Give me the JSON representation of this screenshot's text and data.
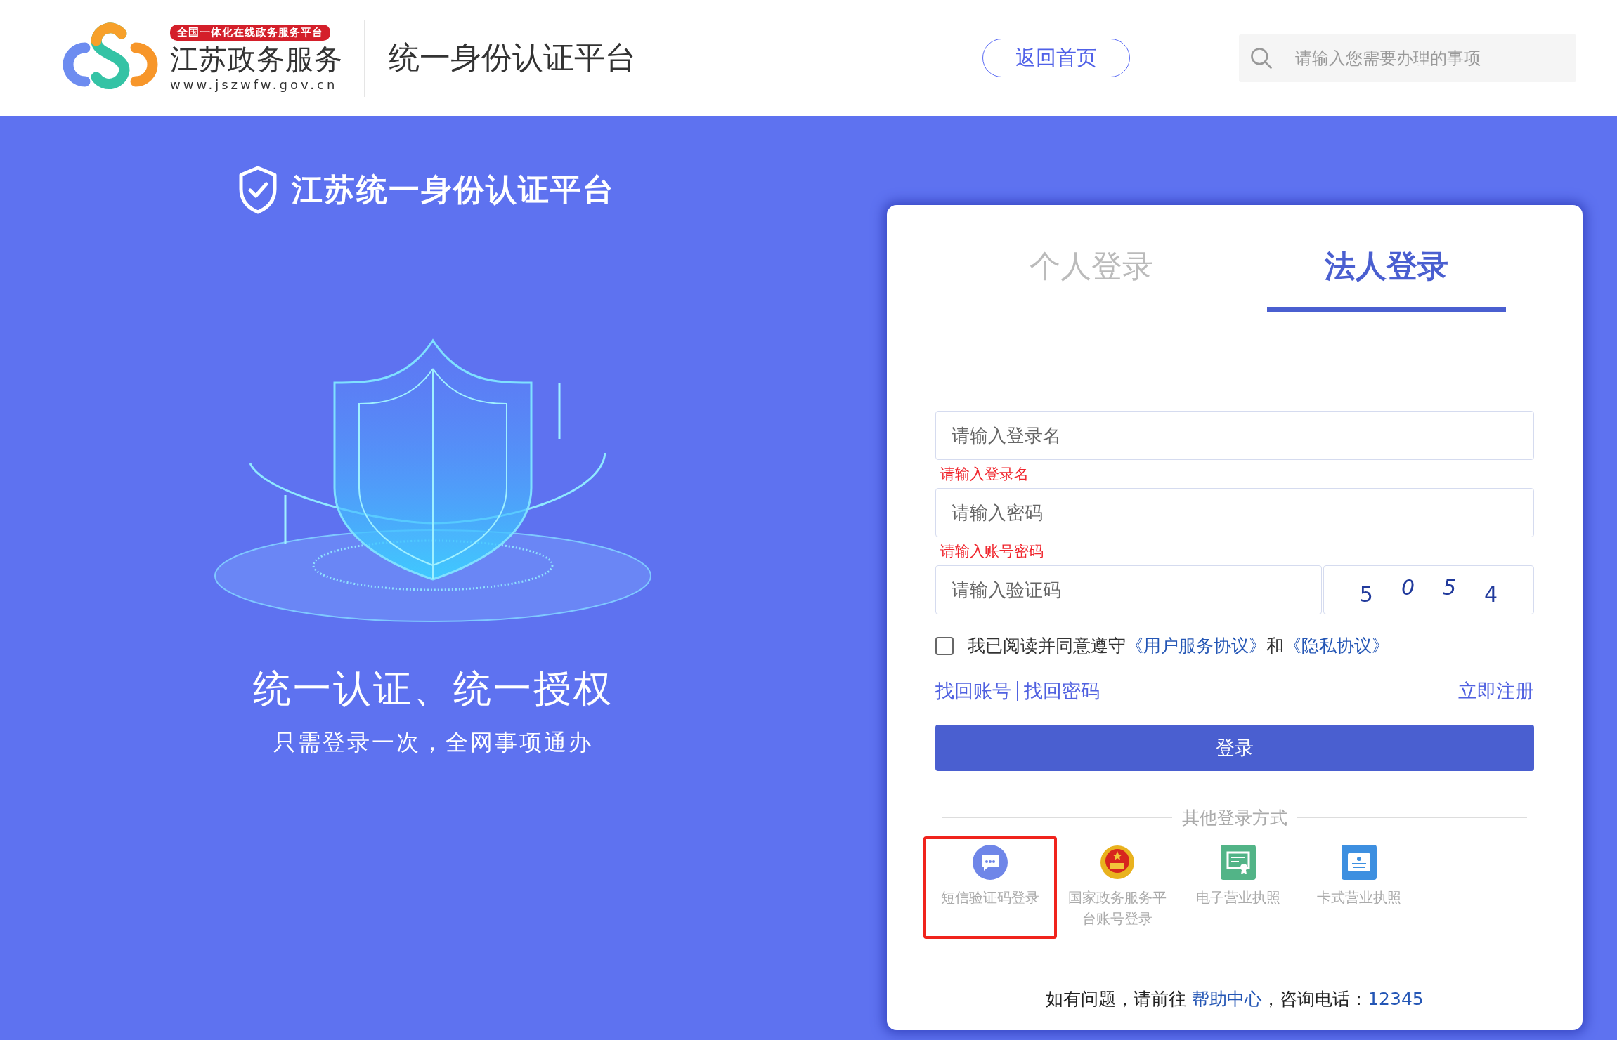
{
  "header": {
    "badge": "全国一体化在线政务服务平台",
    "site_name": "江苏政务服务",
    "site_url": "www.jszwfw.gov.cn",
    "title": "统一身份认证平台",
    "home_button": "返回首页",
    "search": {
      "placeholder": "请输入您需要办理的事项"
    }
  },
  "hero": {
    "title": "江苏统一身份认证平台",
    "slogan": "统一认证、统一授权",
    "subtitle": "只需登录一次，全网事项通办"
  },
  "login": {
    "tabs": [
      {
        "label": "个人登录",
        "selected": false
      },
      {
        "label": "法人登录",
        "selected": true
      }
    ],
    "username": {
      "placeholder": "请输入登录名",
      "error": "请输入登录名"
    },
    "password": {
      "placeholder": "请输入密码",
      "error": "请输入账号密码"
    },
    "captcha": {
      "placeholder": "请输入验证码",
      "digits": [
        "5",
        "0",
        "5",
        "4"
      ]
    },
    "agreement": {
      "checked": false,
      "text": "我已阅读并同意遵守",
      "link1": "《用户服务协议》",
      "joiner": "和",
      "link2": "《隐私协议》"
    },
    "recover_account": "找回账号",
    "recover_password": "找回密码",
    "register": "立即注册",
    "submit": "登录",
    "other_title": "其他登录方式",
    "other_methods": [
      {
        "kind": "sms",
        "label": "短信验证码登录",
        "selected": true
      },
      {
        "kind": "emblem",
        "label": "国家政务服务平台账号登录",
        "selected": false
      },
      {
        "kind": "license",
        "label": "电子营业执照",
        "selected": false
      },
      {
        "kind": "card",
        "label": "卡式营业执照",
        "selected": false
      }
    ],
    "help": {
      "prefix": "如有问题，请前往",
      "link": "帮助中心",
      "middle": "，咨询电话：",
      "phone": "12345"
    }
  }
}
